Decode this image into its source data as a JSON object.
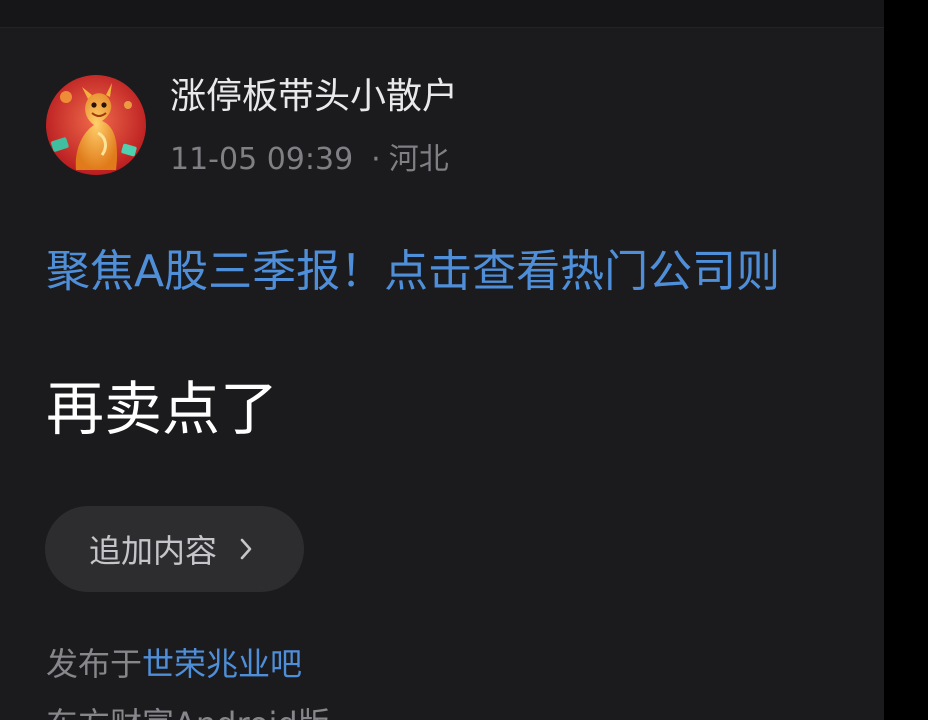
{
  "post": {
    "author": "涨停板带头小散户",
    "datetime": "11-05 09:39",
    "separator": "·",
    "location": "河北",
    "promo_link": "聚焦A股三季报！点击查看热门公司则",
    "text": "再卖点了",
    "append_button": "追加内容",
    "published_prefix": "发布于",
    "published_bar": "世荣兆业吧",
    "source": "东方财富Android版"
  },
  "colors": {
    "background": "#1b1b1d",
    "link": "#4f8fd9",
    "text": "#ffffff",
    "muted": "#86868b",
    "button_bg": "#2d2d30"
  },
  "icons": {
    "avatar": "dragon-avatar",
    "append_chevron": "chevron-right-icon"
  }
}
